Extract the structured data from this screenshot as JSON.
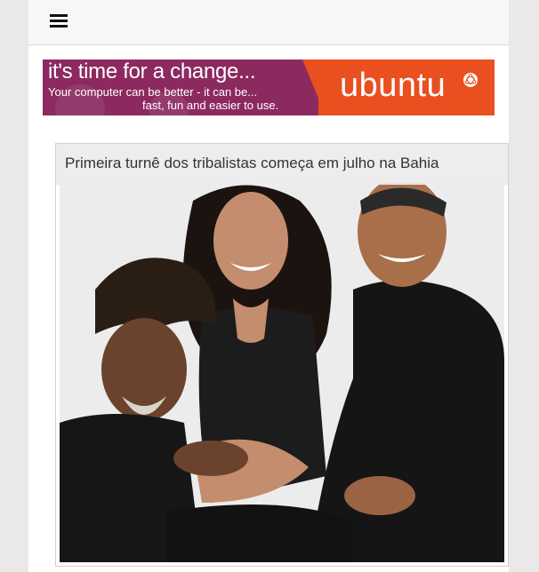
{
  "header": {
    "menu_icon": "hamburger-menu-icon"
  },
  "banner": {
    "headline": "it's time for a change...",
    "subline_1": "Your computer can be better - it can be...",
    "subline_2": "fast, fun and easier to use.",
    "brand": "ubuntu",
    "brand_icon": "ubuntu-circle-of-friends-icon",
    "colors": {
      "left": "#8c2a60",
      "right": "#e94f1f"
    }
  },
  "article": {
    "title": "Primeira turnê dos tribalistas começa em julho na Bahia",
    "image_alt": "photo-of-three-smiling-musicians"
  }
}
